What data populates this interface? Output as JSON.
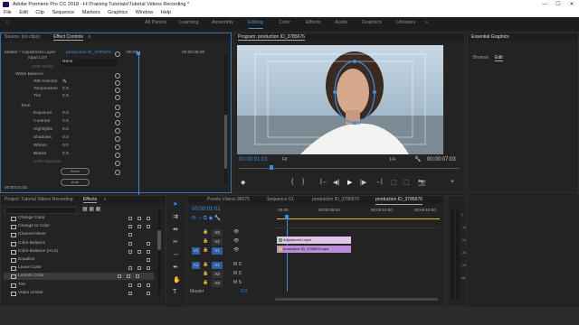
{
  "window": {
    "title": "Adobe Premiere Pro CC 2018 - H:\\Training Tutorials\\Tutorial Videos Recording *",
    "controls": [
      "—",
      "☐",
      "✕"
    ]
  },
  "menu": [
    "File",
    "Edit",
    "Clip",
    "Sequence",
    "Markers",
    "Graphics",
    "Window",
    "Help"
  ],
  "workspaces": {
    "items": [
      "All Panels",
      "Learning",
      "Assembly",
      "Editing",
      "Color",
      "Effects",
      "Audio",
      "Graphics",
      "Libraries"
    ],
    "active": "Editing",
    "overflow": "»"
  },
  "source_panel": {
    "tabs": [
      "Source: (no clips)",
      "Effect Controls"
    ],
    "menu_glyph": "≡",
    "master_label": "Master * Adjustment Layer",
    "clip_label": "production ID_3785676 ...",
    "timecode_zero": ":00:00",
    "timecode_mid": "00:00:05:00",
    "input_lut_label": "Input LUT",
    "input_lut_value": "None",
    "hdr_white": "HDR White",
    "white_balance": "White Balance",
    "wb_selector": "WB Selector",
    "temperature": {
      "label": "Temperature",
      "value": "0.0"
    },
    "tint": {
      "label": "Tint",
      "value": "0.0"
    },
    "tone_label": "Tone",
    "tone": [
      {
        "label": "Exposure",
        "value": "0.0"
      },
      {
        "label": "Contrast",
        "value": "0.0"
      },
      {
        "label": "Highlights",
        "value": "0.0"
      },
      {
        "label": "Shadows",
        "value": "0.0"
      },
      {
        "label": "Whites",
        "value": "0.0"
      },
      {
        "label": "Blacks",
        "value": "0.0"
      }
    ],
    "hdr_specular": "HDR Specular",
    "reset_button": "Reset",
    "auto_button": "Auto",
    "footer_timecode": "00:00:01:01"
  },
  "program": {
    "title": "Program: production ID_3785676",
    "timecode": "00:00:01:01",
    "fit": "Fit",
    "fraction": "1/4",
    "duration": "00:00:07:03",
    "transport": [
      "◆",
      "{",
      "}",
      "|←",
      "◀|",
      "▶",
      "|▶",
      "→|",
      "⬚",
      "⬚",
      "📷",
      "+"
    ]
  },
  "essential_graphics": {
    "title": "Essential Graphics",
    "tabs": [
      "Browse",
      "Edit"
    ],
    "active_tab": "Edit"
  },
  "project_panel": {
    "tabs": [
      "Project: Tutorial Videos Recording",
      "Effects"
    ],
    "overflow": "»",
    "effects": [
      {
        "name": "Change Color",
        "accel": [
          true,
          true,
          true
        ]
      },
      {
        "name": "Change to Color",
        "accel": [
          true,
          true,
          true
        ]
      },
      {
        "name": "Channel Mixer",
        "accel": [
          true,
          false,
          false
        ]
      },
      {
        "name": "Color Balance",
        "accel": [
          true,
          false,
          true
        ]
      },
      {
        "name": "Color Balance (HLS)",
        "accel": [
          true,
          true,
          true
        ]
      },
      {
        "name": "Equalize",
        "accel": [
          false,
          false,
          true
        ]
      },
      {
        "name": "Leave Color",
        "accel": [
          true,
          true,
          true
        ]
      },
      {
        "name": "Lumetri Color",
        "accel": [
          true,
          true,
          true
        ],
        "selected": true
      },
      {
        "name": "Tint",
        "accel": [
          true,
          true,
          true
        ]
      },
      {
        "name": "Video Limiter",
        "accel": [
          true,
          false,
          true
        ]
      }
    ]
  },
  "timeline": {
    "tabs": [
      "Pexels Videos 99275",
      "Sequence 01",
      "production ID_3785676",
      "production ID_3785676"
    ],
    "active_tab_index": 3,
    "timecode": "00:00:01:01",
    "ruler": [
      ":00:00",
      "00:00:05:00",
      "00:00:10:00",
      "00:00:15:00"
    ],
    "video_tracks": [
      "V3",
      "V2",
      "V1"
    ],
    "audio_tracks": [
      "A1",
      "A2",
      "A3"
    ],
    "source_video": "V1",
    "source_audio": "A1",
    "master": {
      "label": "Master",
      "value": "0.0"
    },
    "clips": [
      {
        "name": "Adjustment Layer",
        "track": "V2"
      },
      {
        "name": "production ID_3785676.mp4",
        "track": "V1"
      }
    ]
  },
  "audio_meter": {
    "scale": [
      "0",
      "-12",
      "-24",
      "-36",
      "-48",
      "dB"
    ]
  },
  "colors": {
    "accent": "#3a8ee6",
    "adjustment_clip": "#e0c0e8",
    "video_clip": "#b98ed6",
    "panel_bg": "#232323"
  }
}
